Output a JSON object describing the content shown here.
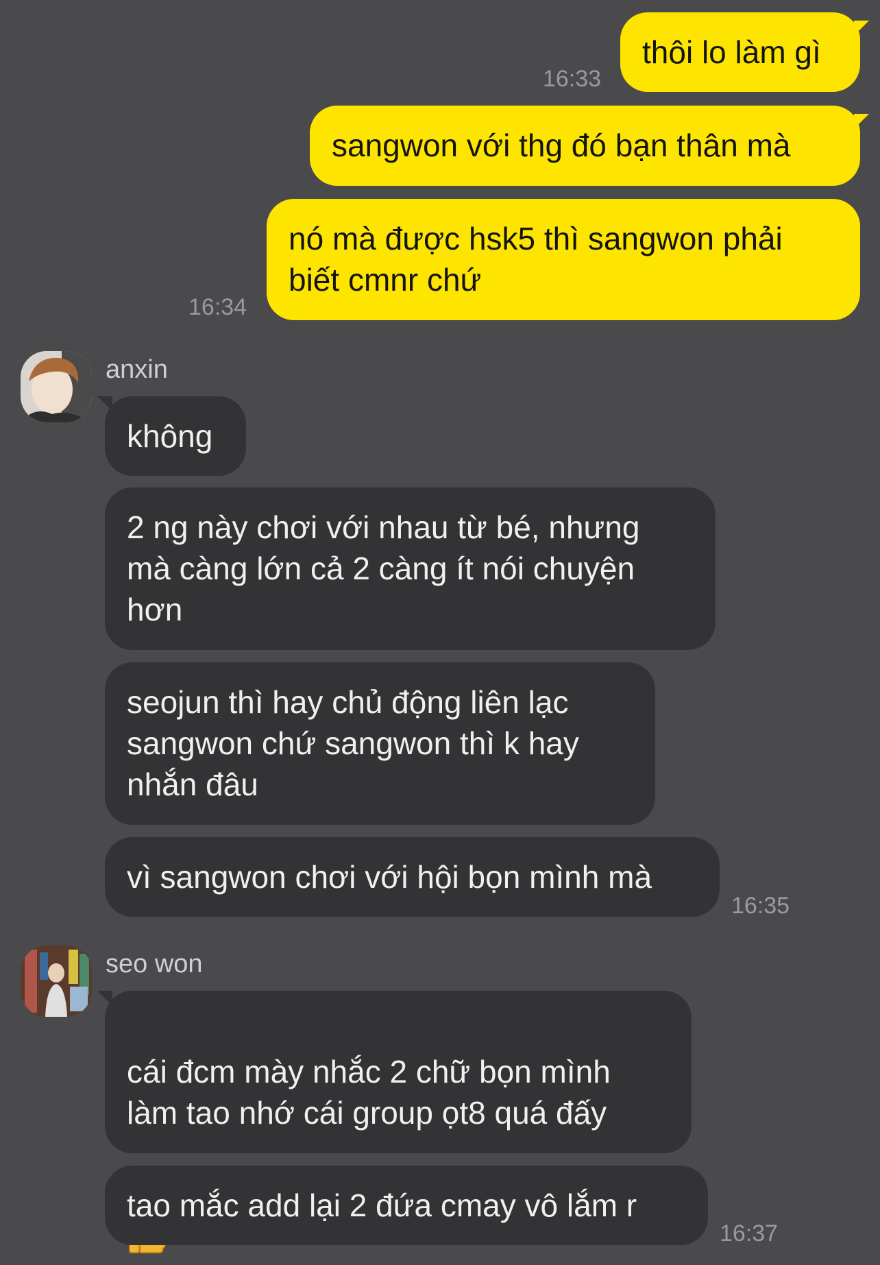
{
  "messages_out": [
    {
      "text": "thôi lo làm gì",
      "time": "16:33"
    },
    {
      "text": "sangwon với thg đó bạn thân mà",
      "time": ""
    },
    {
      "text": "nó mà được hsk5 thì sangwon phải\nbiết cmnr chứ",
      "time": "16:34"
    }
  ],
  "group1": {
    "sender": "anxin",
    "messages": [
      {
        "text": "không"
      },
      {
        "text": "2 ng này chơi với nhau từ bé, nhưng\nmà càng lớn cả 2 càng ít nói chuyện\nhơn"
      },
      {
        "text": "seojun thì hay chủ động liên lạc\nsangwon chứ sangwon thì k hay\nnhắn đâu"
      },
      {
        "text": "vì sangwon chơi với hội bọn mình mà",
        "time": "16:35"
      }
    ]
  },
  "group2": {
    "sender": "seo won",
    "messages": [
      {
        "text": "cái đcm mày nhắc 2 chữ bọn mình\nlàm tao nhớ cái group ọt8 quá đấy",
        "emoji": "thumbs-up"
      },
      {
        "text": "tao mắc add lại 2 đứa cmay vô lắm r",
        "time": "16:37"
      }
    ]
  },
  "colors": {
    "background": "#4a4a4c",
    "outgoing_bubble": "#fee500",
    "incoming_bubble": "#333335"
  }
}
